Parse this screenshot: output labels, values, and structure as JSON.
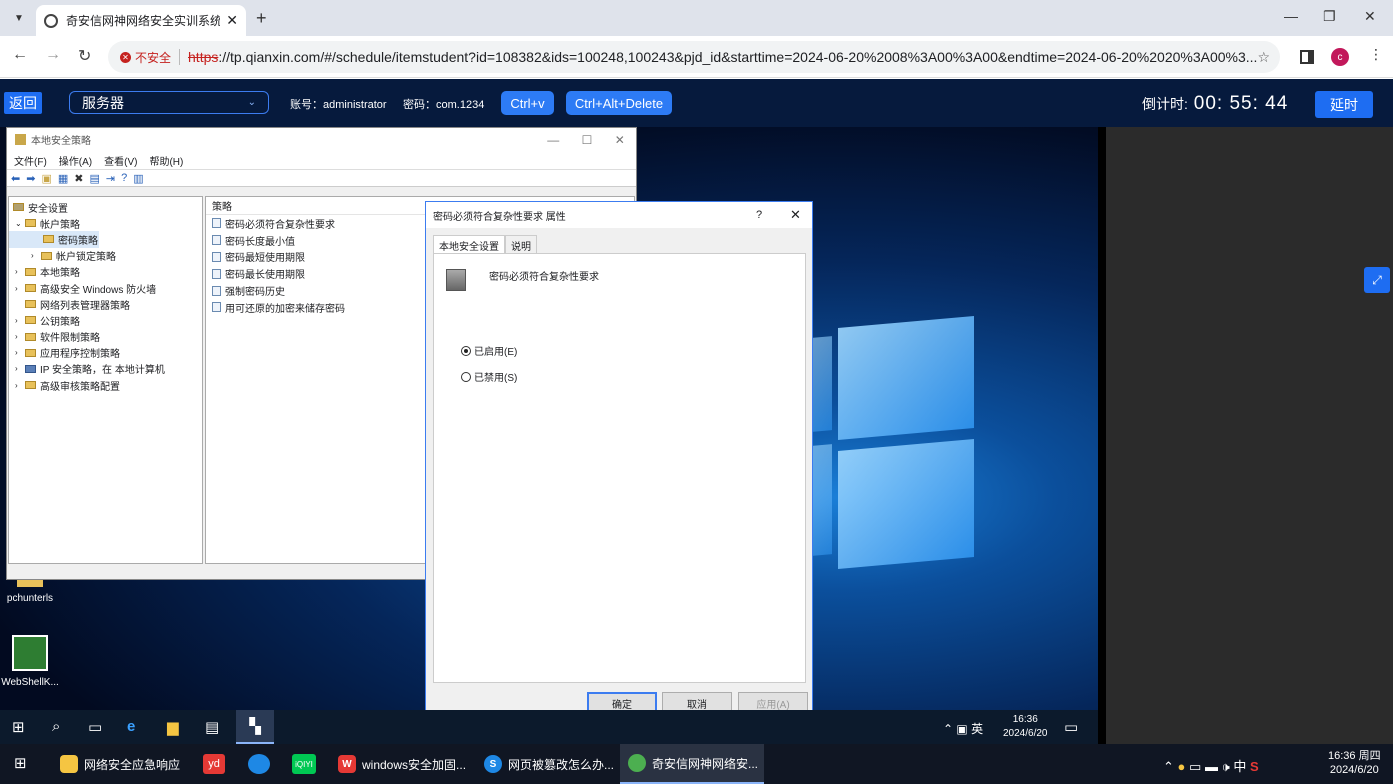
{
  "browser": {
    "tab_title": "奇安信网神网络安全实训系统V",
    "tab_close": "✕",
    "new_tab": "+",
    "security_label": "不安全",
    "url_protocol": "https",
    "url_rest": "://tp.qianxin.com/#/schedule/itemstudent?id=108382&ids=100248,100243&pjd_id&starttime=2024-06-20%2008%3A00%3A00&endtime=2024-06-20%2020%3A00%3...",
    "profile_initial": "c"
  },
  "appbar": {
    "back_label": "返回",
    "server_label": "服务器",
    "account_text": "账号：administrator",
    "password_text": "密码：com.1234",
    "ctrlv_label": "Ctrl+v",
    "cad_label": "Ctrl+Alt+Delete",
    "countdown_label": "倒计时:",
    "countdown_value": "00: 55: 44",
    "delay_label": "延时"
  },
  "mmc": {
    "title": "本地安全策略",
    "menu": [
      "文件(F)",
      "操作(A)",
      "查看(V)",
      "帮助(H)"
    ],
    "tree": [
      "安全设置",
      "帐户策略",
      "密码策略",
      "帐户锁定策略",
      "本地策略",
      "高级安全 Windows 防火墙",
      "网络列表管理器策略",
      "公钥策略",
      "软件限制策略",
      "应用程序控制策略",
      "IP 安全策略，在 本地计算机",
      "高级审核策略配置"
    ],
    "list_header": "策略",
    "list": [
      "密码必须符合复杂性要求",
      "密码长度最小值",
      "密码最短使用期限",
      "密码最长使用期限",
      "强制密码历史",
      "用可还原的加密来储存密码"
    ]
  },
  "dialog": {
    "title": "密码必须符合复杂性要求 属性",
    "help": "?",
    "close": "✕",
    "tab_local": "本地安全设置",
    "tab_explain": "说明",
    "policy_name": "密码必须符合复杂性要求",
    "enabled_label": "已启用(E)",
    "disabled_label": "已禁用(S)",
    "selected": "enabled",
    "ok_label": "确定",
    "cancel_label": "取消",
    "apply_label": "应用(A)"
  },
  "desktop_icons": [
    "pchunterls",
    "WebShellK..."
  ],
  "inner_taskbar": {
    "ime": "英",
    "time": "16:36",
    "date": "2024/6/20"
  },
  "host_taskbar": {
    "items": [
      {
        "label": "网络安全应急响应",
        "color": "#f5c542"
      },
      {
        "label": "windows安全加固...",
        "color": "#e53935"
      },
      {
        "label": "网页被篡改怎么办...",
        "color": "#1e88e5"
      },
      {
        "label": "奇安信网神网络安...",
        "color": "#4caf50"
      }
    ],
    "ime": "中",
    "time": "16:36 周四",
    "date": "2024/6/20"
  },
  "colors": {
    "appbar_bg": "#061a3d",
    "accent": "#1e6df2",
    "insecure": "#c5221f"
  }
}
